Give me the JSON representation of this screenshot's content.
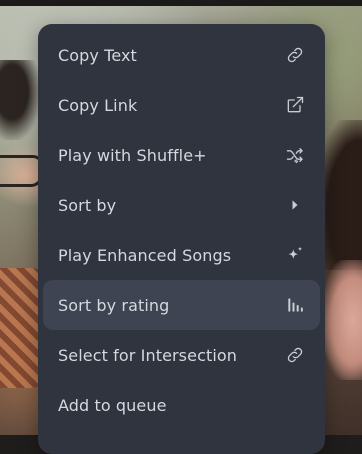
{
  "context_menu": {
    "items": [
      {
        "label": "Copy Text",
        "icon": "link-icon",
        "selected": false
      },
      {
        "label": "Copy Link",
        "icon": "external-link-icon",
        "selected": false
      },
      {
        "label": "Play with Shuffle+",
        "icon": "shuffle-icon",
        "selected": false
      },
      {
        "label": "Sort by",
        "icon": "chevron-right-icon",
        "selected": false
      },
      {
        "label": "Play Enhanced Songs",
        "icon": "sparkle-icon",
        "selected": false
      },
      {
        "label": "Sort by rating",
        "icon": "bar-chart-icon",
        "selected": true
      },
      {
        "label": "Select for Intersection",
        "icon": "link-icon",
        "selected": false
      },
      {
        "label": "Add to queue",
        "icon": "",
        "selected": false
      }
    ]
  },
  "colors": {
    "menu_background": "#30343e",
    "selected_background": "#3e4451",
    "text": "#d5d8de",
    "icon": "#c9ccd3"
  }
}
